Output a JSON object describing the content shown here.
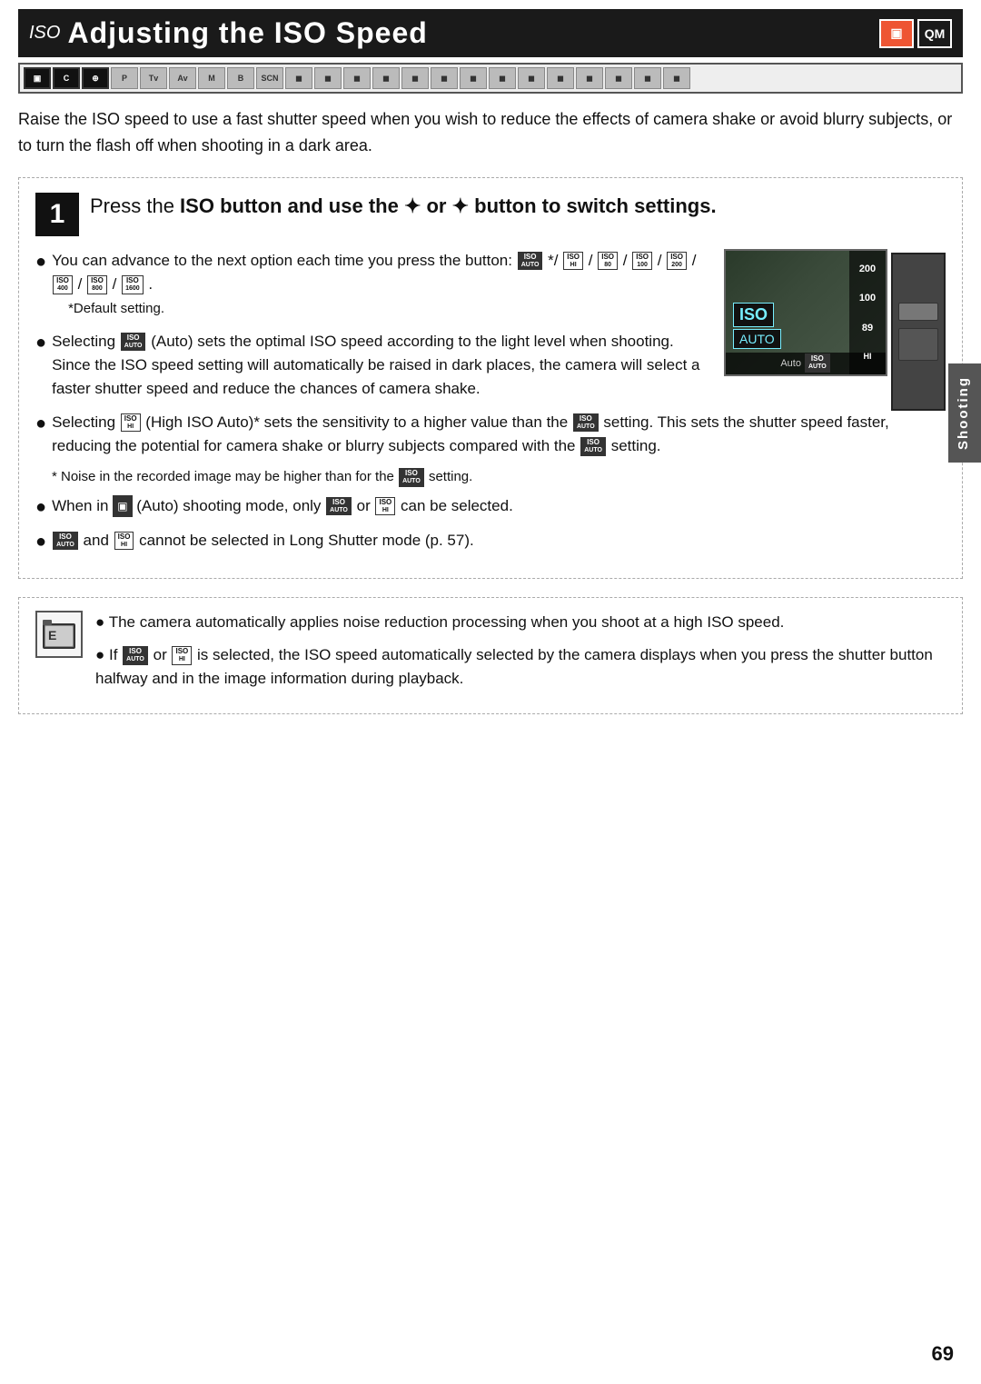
{
  "page": {
    "number": "69"
  },
  "side_tab": {
    "label": "Shooting"
  },
  "header": {
    "iso_prefix": "ISO",
    "title": "Adjusting the ISO Speed",
    "icon1": "▣",
    "icon2": "QM",
    "mode_icons": [
      "▣",
      "C",
      "⊕",
      "P",
      "Tv",
      "Av",
      "M",
      "B",
      "SCN",
      "◻",
      "◻",
      "◻",
      "◻",
      "◻",
      "◻",
      "◻",
      "◻",
      "◻",
      "◻",
      "◻",
      "◻",
      "◻",
      "◻",
      "◻"
    ]
  },
  "intro": {
    "text": "Raise the ISO speed to use a fast shutter speed when you wish to reduce the effects of camera shake or avoid blurry subjects, or to turn the flash off when shooting in a dark area."
  },
  "step1": {
    "number": "1",
    "title_part1": "Press the",
    "title_iso": "ISO",
    "title_part2": "button and use the ✦ or ✦ button to switch settings."
  },
  "bullets": [
    {
      "id": "b1",
      "text": "You can advance to the next option each time you press the button:",
      "badges": [
        "AUTO",
        "HI",
        "80",
        "100",
        "200",
        "400",
        "800",
        "1600"
      ],
      "default_note": "*Default setting."
    },
    {
      "id": "b2",
      "text": "Selecting",
      "badge": "AUTO",
      "rest": "(Auto) sets the optimal ISO speed according to the light level when shooting. Since the ISO speed setting will automatically be raised in dark places, the camera will select a faster shutter speed and reduce the chances of camera shake."
    },
    {
      "id": "b3",
      "text": "Selecting",
      "badge": "HI",
      "rest": "(High ISO Auto)* sets the sensitivity to a higher value than the",
      "badge2": "AUTO",
      "rest2": "setting. This sets the shutter speed faster, reducing the potential for camera shake or blurry subjects compared with the",
      "badge3": "AUTO",
      "rest3": "setting."
    },
    {
      "id": "b3note",
      "text": "* Noise in the recorded image may be higher than for the",
      "badge": "AUTO",
      "rest": "setting."
    },
    {
      "id": "b4",
      "text": "When in",
      "badge": "AUTO_MODE",
      "rest": "(Auto) shooting mode, only",
      "badge2": "AUTO",
      "or_text": "or",
      "badge3": "HI",
      "rest2": "can be selected."
    },
    {
      "id": "b5",
      "badge1": "AUTO",
      "and_text": "and",
      "badge2": "HI",
      "rest": "cannot be selected in Long Shutter mode (p. 57)."
    }
  ],
  "notes": [
    {
      "id": "n1",
      "text": "The camera automatically applies noise reduction processing when you shoot at a high ISO speed."
    },
    {
      "id": "n2",
      "text": "If",
      "badge1": "AUTO",
      "or_text": "or",
      "badge2": "HI",
      "rest": "is selected, the ISO speed automatically selected by the camera displays when you press the shutter button halfway and in the image information during playback."
    }
  ]
}
